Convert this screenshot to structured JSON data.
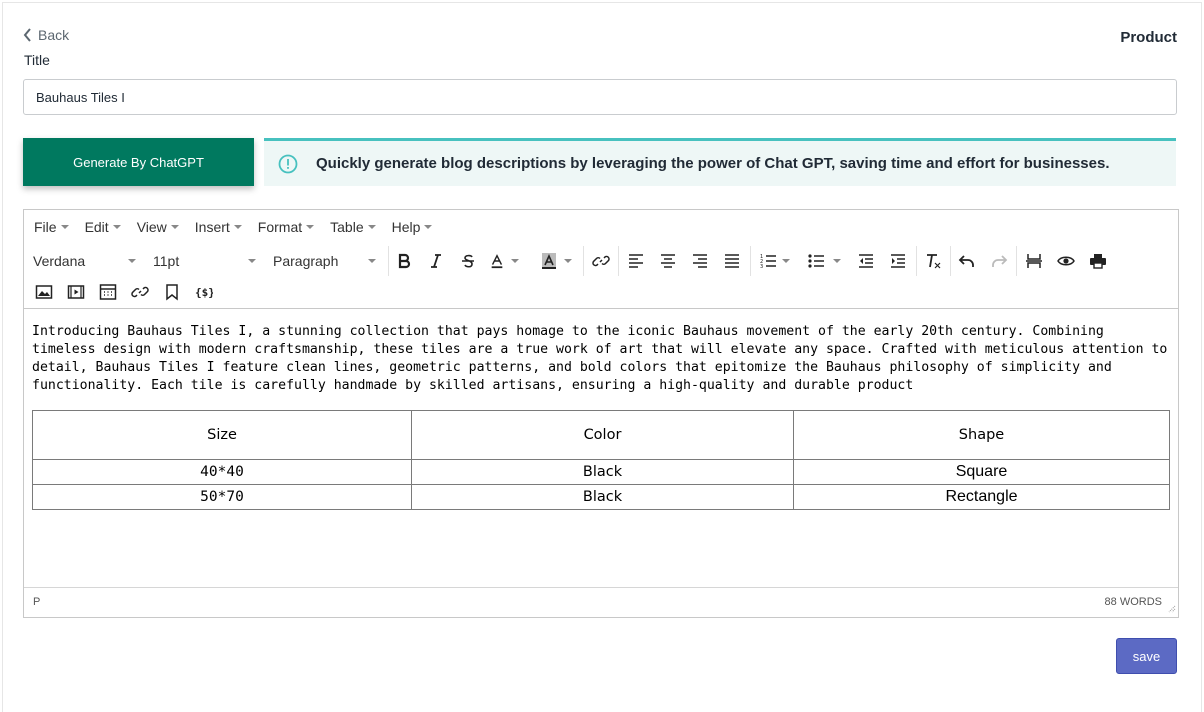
{
  "header": {
    "back_label": "Back",
    "page_title": "Product"
  },
  "title_field": {
    "label": "Title",
    "value": "Bauhaus Tiles I"
  },
  "generate_button": {
    "label": "Generate By ChatGPT"
  },
  "banner": {
    "text": "Quickly generate blog descriptions by leveraging the power of Chat GPT, saving time and effort for businesses."
  },
  "editor": {
    "menu": [
      "File",
      "Edit",
      "View",
      "Insert",
      "Format",
      "Table",
      "Help"
    ],
    "font_family": "Verdana",
    "font_size": "11pt",
    "block_format": "Paragraph",
    "content_paragraph": "Introducing Bauhaus Tiles I, a stunning collection that pays homage to the iconic Bauhaus movement of the early 20th century. Combining timeless design with modern craftsmanship, these tiles are a true work of art that will elevate any space. Crafted with meticulous attention to detail, Bauhaus Tiles I feature clean lines, geometric patterns, and bold colors that epitomize the Bauhaus philosophy of simplicity and functionality. Each tile is carefully handmade by skilled artisans, ensuring a high-quality and durable product",
    "table": {
      "headers": [
        "Size",
        "Color",
        "Shape"
      ],
      "rows": [
        [
          "40*40",
          "Black",
          "Square"
        ],
        [
          "50*70",
          "Black",
          "Rectangle"
        ]
      ]
    },
    "status_path": "P",
    "word_count": "88 WORDS"
  },
  "save_button": {
    "label": "save"
  },
  "colors": {
    "generate_button": "#00795f",
    "banner_border": "#47c1bf",
    "banner_bg": "#eef7f6",
    "save_button": "#5c6ac4"
  }
}
